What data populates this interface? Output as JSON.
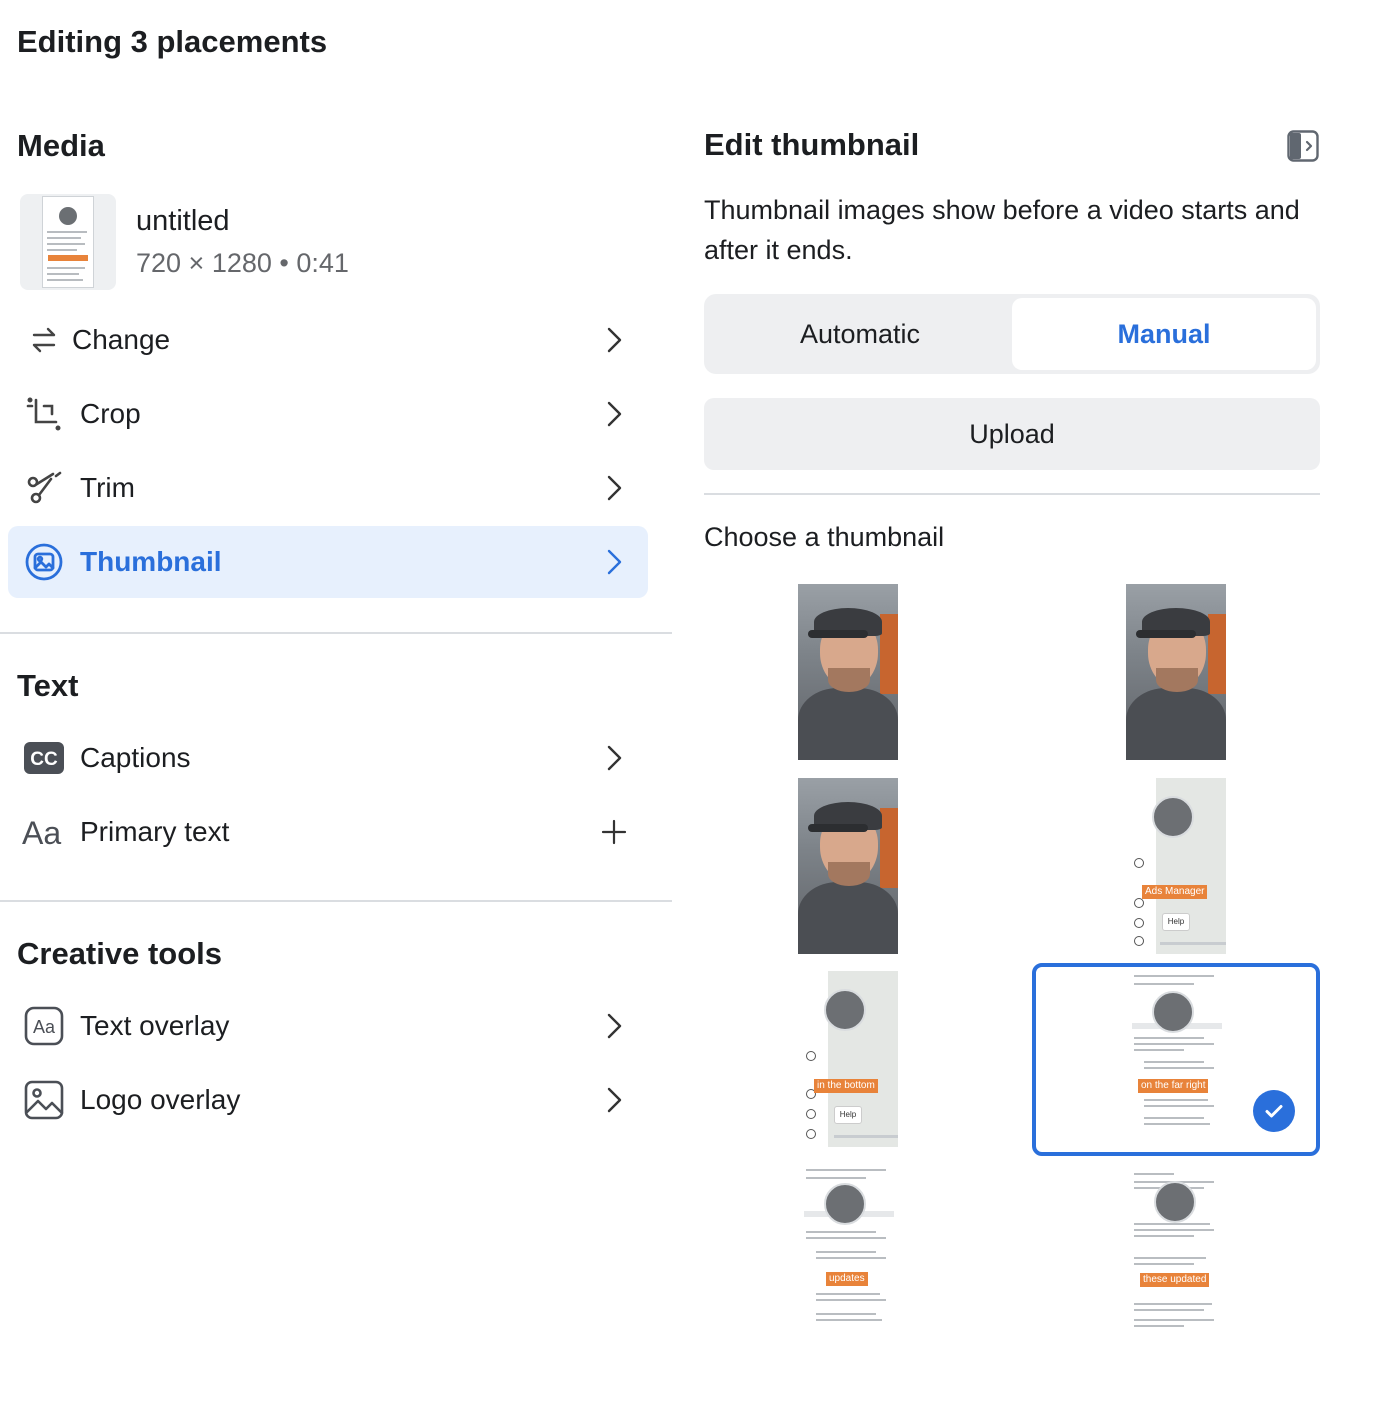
{
  "page_title": "Editing 3 placements",
  "media": {
    "section_title": "Media",
    "file_name": "untitled",
    "file_meta": "720 × 1280 • 0:41",
    "items": [
      {
        "label": "Change",
        "icon": "swap-icon"
      },
      {
        "label": "Crop",
        "icon": "crop-icon"
      },
      {
        "label": "Trim",
        "icon": "scissors-icon"
      },
      {
        "label": "Thumbnail",
        "icon": "image-icon",
        "active": true
      }
    ]
  },
  "text": {
    "section_title": "Text",
    "items": [
      {
        "label": "Captions",
        "icon": "cc-icon"
      },
      {
        "label": "Primary text",
        "icon": "text-aa-icon"
      }
    ]
  },
  "creative_tools": {
    "section_title": "Creative tools",
    "items": [
      {
        "label": "Text overlay",
        "icon": "text-overlay-icon"
      },
      {
        "label": "Logo overlay",
        "icon": "logo-overlay-icon"
      }
    ]
  },
  "edit_thumbnail": {
    "title": "Edit thumbnail",
    "description": "Thumbnail images show before a video starts and after it ends.",
    "mode_options": [
      "Automatic",
      "Manual"
    ],
    "selected_mode": "Manual",
    "upload_label": "Upload",
    "choose_label": "Choose a thumbnail",
    "thumbnails": [
      {
        "type": "photo"
      },
      {
        "type": "photo"
      },
      {
        "type": "photo"
      },
      {
        "type": "screen",
        "overlay_text": "Ads Manager",
        "help_text": "Help"
      },
      {
        "type": "screen",
        "overlay_text": "in the bottom",
        "help_text": "Help"
      },
      {
        "type": "screen",
        "overlay_text": "on the far right",
        "selected": true
      },
      {
        "type": "screen",
        "overlay_text": "updates"
      },
      {
        "type": "screen",
        "overlay_text": "these updated"
      }
    ]
  },
  "colors": {
    "accent": "#2a6fdb",
    "active_bg": "#e7f0fd",
    "overlay_tag": "#e8833a"
  }
}
